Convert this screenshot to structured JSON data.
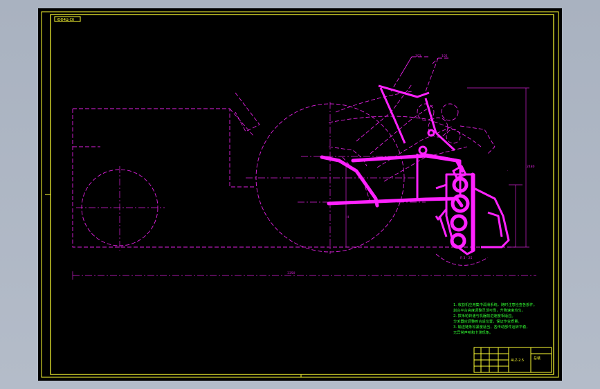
{
  "drawing": {
    "code_label": "ЮФ4Ц-Сб",
    "notes": [
      "1. 收割机应用集中润滑系统，随时注意检查各部件。",
      "   割台平台高度调整灵活可靠，升降速度均匀。",
      "2. 拨禾轮转速与机器前进速度相适应。",
      "   分禾器应调整到合适位置，保证作业质量。",
      "3. 输送链条松紧度适当，各传动部件运转平稳，",
      "   无异常声响和卡滞现象。",
      "4. 整机装配完毕后应进行空运转试验。"
    ],
    "title_block": {
      "drawing_title": "4LZ-2.5",
      "sheet_no": "总装"
    }
  }
}
